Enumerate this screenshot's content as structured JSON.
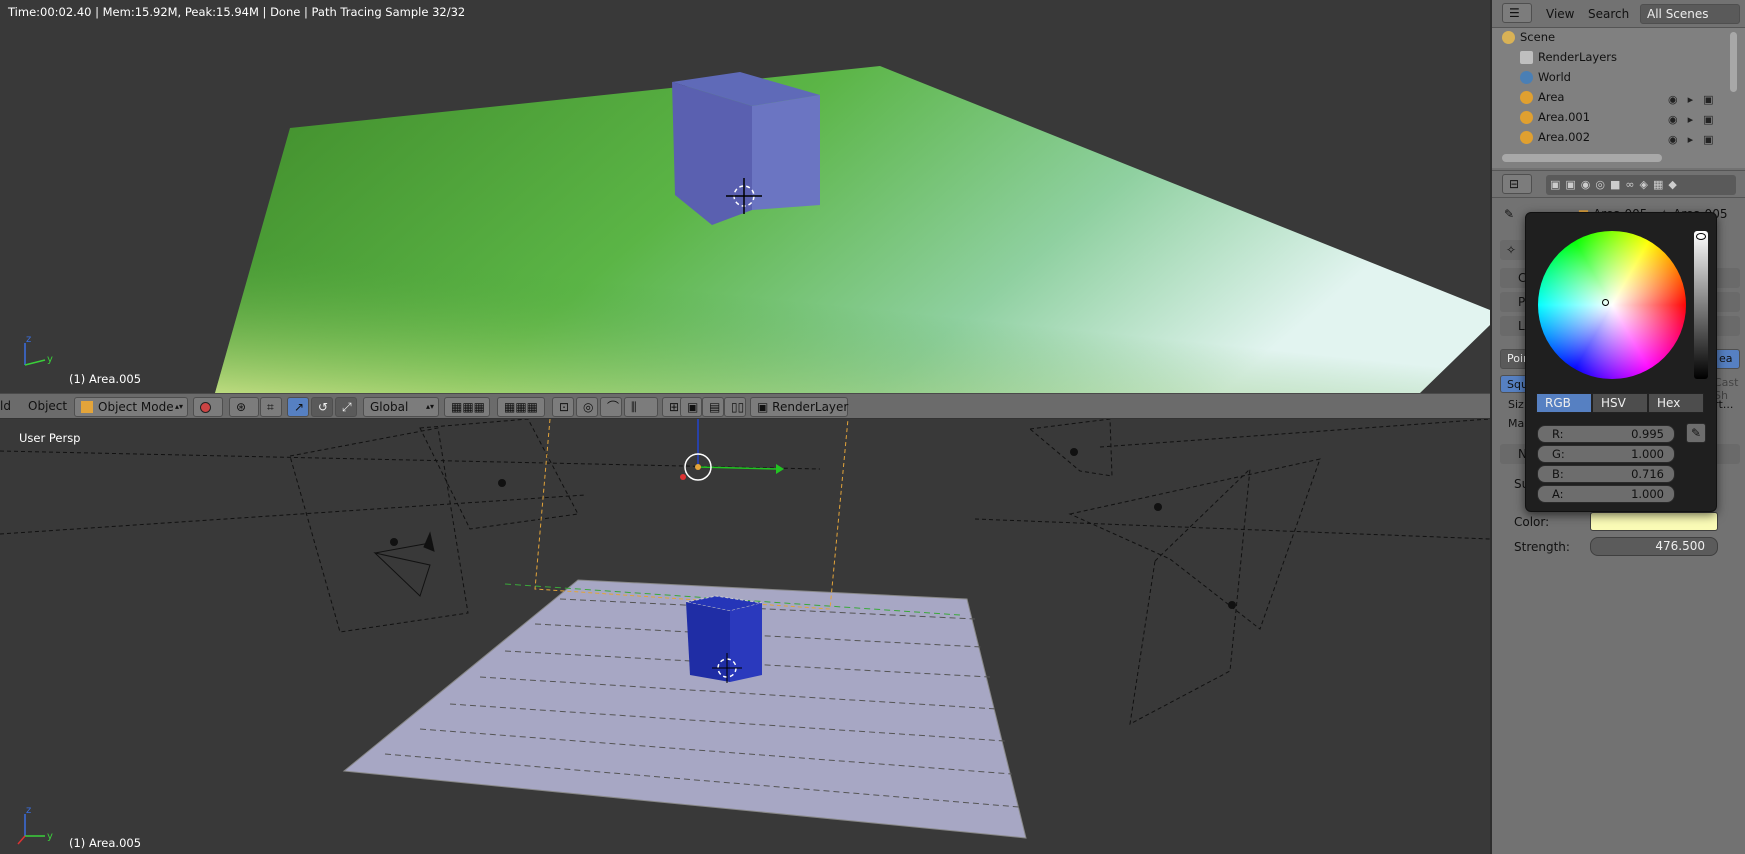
{
  "render_view": {
    "info": "Time:00:02.40 | Mem:15.92M, Peak:15.94M | Done | Path Tracing Sample 32/32",
    "object_label": "(1) Area.005"
  },
  "header3d": {
    "menu_cut": "ld",
    "object_menu": "Object",
    "mode": "Object Mode",
    "orientation": "Global",
    "render_layer": "RenderLayer"
  },
  "scene_view": {
    "view_label": "User Persp",
    "object_label": "(1) Area.005"
  },
  "outliner": {
    "view_menu": "View",
    "search_menu": "Search",
    "scenes_select": "All Scenes",
    "items": [
      {
        "label": "Scene",
        "icon": "scene-icon",
        "color": "#d9b256"
      },
      {
        "label": "RenderLayers",
        "icon": "render-layers-icon",
        "color": "#bfbfbf"
      },
      {
        "label": "World",
        "icon": "world-icon",
        "color": "#4a7fb5"
      },
      {
        "label": "Area",
        "icon": "lamp-icon",
        "color": "#e0a030"
      },
      {
        "label": "Area.001",
        "icon": "lamp-icon",
        "color": "#e0a030"
      },
      {
        "label": "Area.002",
        "icon": "lamp-icon",
        "color": "#e0a030"
      }
    ]
  },
  "properties": {
    "breadcrumb_object": "Area.005",
    "breadcrumb_data": "Area.005",
    "panel_labels": [
      "Cc",
      "Pr",
      "La"
    ],
    "lamp_type_point": "Point",
    "lamp_type_area": "ea",
    "shape_square": "Square",
    "size_label": "Siz",
    "map_label": "Ma",
    "nodes_label": "N",
    "surface_label": "Surf",
    "color_label": "Color:",
    "strength_label": "Strength:",
    "strength_value": "476.500",
    "color_value": "#fafbb6",
    "cast_shadow": "Cast Sh",
    "ortho": "rt..."
  },
  "color_picker": {
    "modes": [
      "RGB",
      "HSV",
      "Hex"
    ],
    "active_mode": "RGB",
    "fields": [
      {
        "label": "R:",
        "value": "0.995"
      },
      {
        "label": "G:",
        "value": "1.000"
      },
      {
        "label": "B:",
        "value": "0.716"
      },
      {
        "label": "A:",
        "value": "1.000"
      }
    ]
  }
}
